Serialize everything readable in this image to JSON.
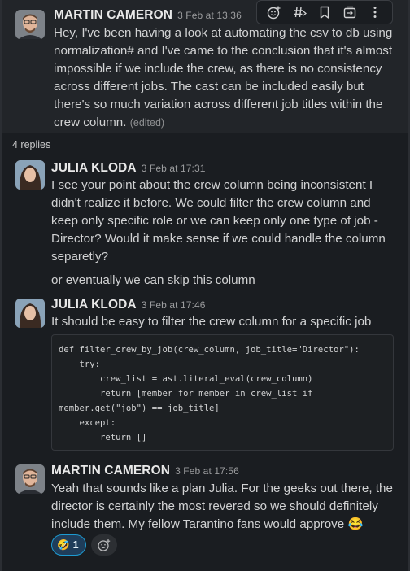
{
  "thread": {
    "parent": {
      "author": "MARTIN CAMERON",
      "timestamp": "3 Feb at 13:36",
      "text": "Hey, I've been having a look at automating the csv to db using normalization# and I've came to the conclusion that it's almost impossible if we include the crew, as there is no consistency across different jobs. The cast can be included easily but there's so much variation across different job titles within the crew column.",
      "edited_label": "(edited)"
    },
    "toolbar": {
      "icons": [
        "add-reaction-icon",
        "hashtag-icon",
        "bookmark-icon",
        "forward-icon",
        "more-icon"
      ]
    },
    "replies_label": "4 replies",
    "replies": [
      {
        "author": "JULIA KLODA",
        "timestamp": "3 Feb at 17:31",
        "text": "I see your point about the crew column being inconsistent I didn't realize it before. We could filter the crew column and keep only specific role or we can keep only one type of job - Director?  Would it make sense if we could handle the column separetly?",
        "text2": "or eventually we can skip this column"
      },
      {
        "author": "JULIA KLODA",
        "timestamp": "3 Feb at 17:46",
        "text": "It should be easy to filter the crew column for a specific job",
        "code": "def filter_crew_by_job(crew_column, job_title=\"Director\"):\n    try:\n        crew_list = ast.literal_eval(crew_column)\n        return [member for member in crew_list if\nmember.get(\"job\") == job_title]\n    except:\n        return []"
      },
      {
        "author": "MARTIN CAMERON",
        "timestamp": "3 Feb at 17:56",
        "text": "Yeah that sounds like a plan Julia. For the geeks out there, the director is certainly the most revered so we should definitely include them. My fellow Tarantino fans would approve",
        "text_emoji": "😂",
        "reactions": [
          {
            "emoji": "🤣",
            "count": "1"
          }
        ]
      }
    ]
  }
}
